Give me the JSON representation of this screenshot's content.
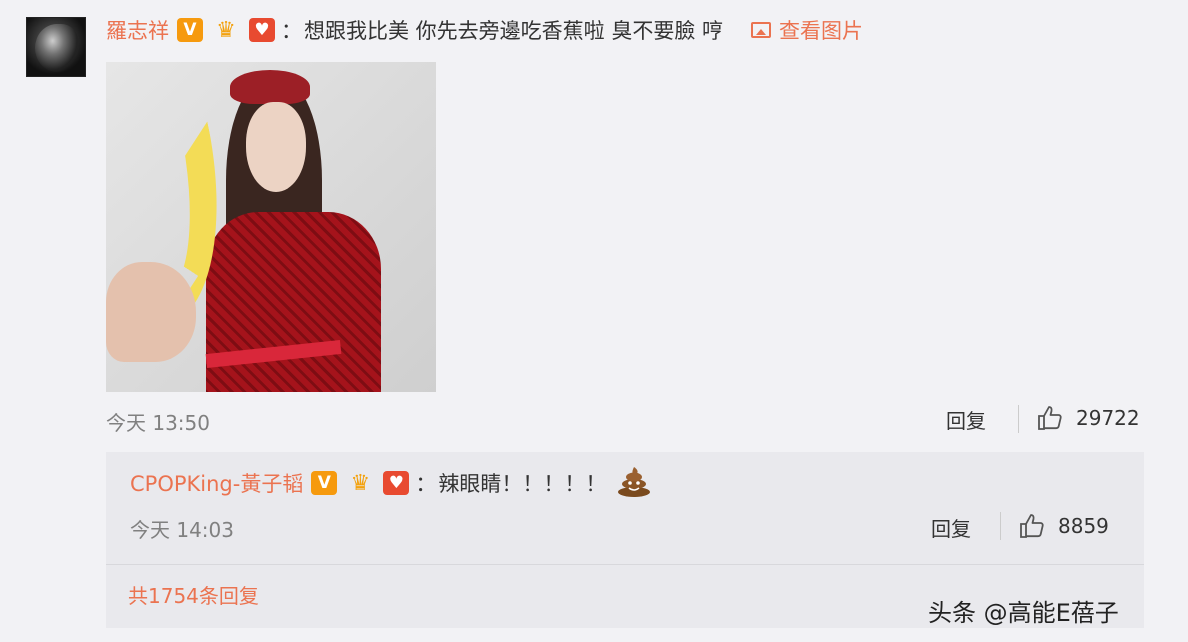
{
  "comment": {
    "username": "羅志祥",
    "colon": "：",
    "content": "想跟我比美 你先去旁邊吃香蕉啦 臭不要臉 哼",
    "view_picture_label": "查看图片",
    "badges": [
      "v-verified-icon",
      "crown-member-icon",
      "red-heart-badge-icon"
    ],
    "time": "今天 13:50",
    "reply_label": "回复",
    "like_count": "29722"
  },
  "sub_reply": {
    "username": "CPOPKing-黃子韬",
    "colon": "：",
    "content": "辣眼睛！！！！！",
    "emoji": "poop-icon",
    "time": "今天 14:03",
    "reply_label": "回复",
    "like_count": "8859",
    "more_replies_label": "共1754条回复"
  },
  "watermark": "头条 @高能E蓓子",
  "colors": {
    "accent": "#eb7350",
    "v_badge": "#f69a0e",
    "heart_badge": "#e84a30",
    "background": "#f2f2f5",
    "sub_background": "#e9e9ed"
  }
}
